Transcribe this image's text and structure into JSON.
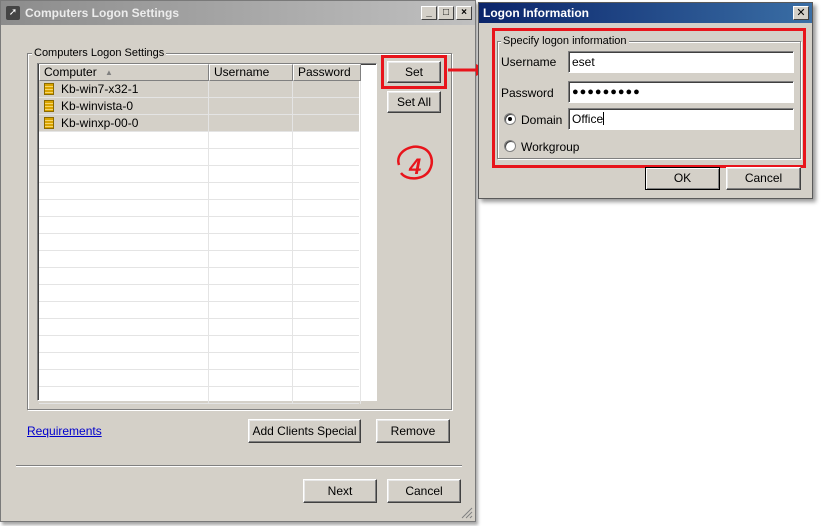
{
  "main_window": {
    "title": "Computers Logon Settings",
    "group_label": "Computers Logon Settings",
    "columns": [
      "Computer",
      "Username",
      "Password"
    ],
    "sort_indicator": "▲",
    "rows": [
      {
        "computer": "Kb-win7-x32-1",
        "username": "",
        "password": ""
      },
      {
        "computer": "Kb-winvista-0",
        "username": "",
        "password": ""
      },
      {
        "computer": "Kb-winxp-00-0",
        "username": "",
        "password": ""
      }
    ],
    "set_label": "Set",
    "set_all_label": "Set All",
    "step_number": "4",
    "requirements_link": "Requirements",
    "add_clients_special_label": "Add Clients Special",
    "remove_label": "Remove",
    "next_label": "Next",
    "cancel_label": "Cancel"
  },
  "logon_dialog": {
    "title": "Logon Information",
    "group_label": "Specify logon information",
    "username_label": "Username",
    "username_value": "eset",
    "password_label": "Password",
    "password_value": "●●●●●●●●●",
    "domain_label": "Domain",
    "domain_value": "Office",
    "workgroup_label": "Workgroup",
    "ok_label": "OK",
    "cancel_label": "Cancel",
    "close_glyph": "✕"
  },
  "colors": {
    "highlight_red": "#e8141b",
    "dialog_title_bg": "#0a246a",
    "inactive_title_bg": "#8c8c8c",
    "window_bg": "#d4d0c8"
  }
}
